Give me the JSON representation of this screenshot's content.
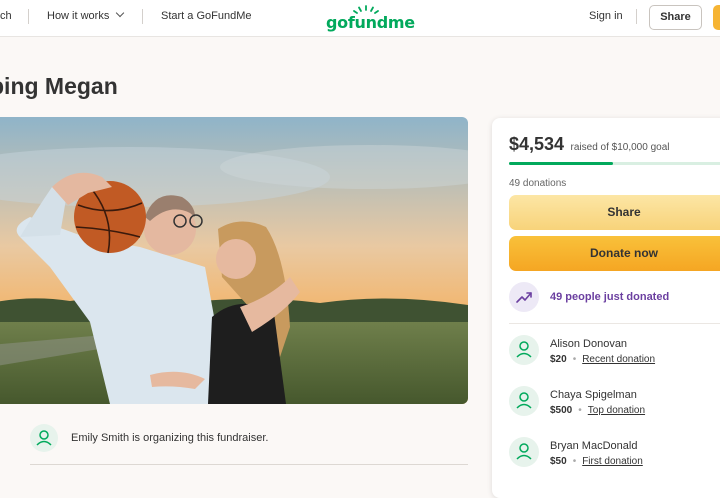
{
  "header": {
    "search_label": "ch",
    "how_it_works_label": "How it works",
    "start_label": "Start a GoFundMe",
    "logo_text": "gofundme",
    "sign_in_label": "Sign in",
    "share_label": "Share"
  },
  "page": {
    "title": "ping Megan"
  },
  "organizer": {
    "text": "Emily Smith is organizing this fundraiser."
  },
  "donate_card": {
    "raised_amount": "$4,534",
    "raised_text": "raised of $10,000 goal",
    "progress_fraction": 0.4534,
    "donation_count": "49 donations",
    "share_button": "Share",
    "donate_button": "Donate now",
    "trend_text": "49 people just donated",
    "donors": [
      {
        "name": "Alison Donovan",
        "amount": "$20",
        "tag": "Recent donation"
      },
      {
        "name": "Chaya Spigelman",
        "amount": "$500",
        "tag": "Top donation"
      },
      {
        "name": "Bryan MacDonald",
        "amount": "$50",
        "tag": "First donation"
      }
    ]
  },
  "colors": {
    "brand_green": "#02a95c",
    "donate_orange": "#f5a623",
    "trend_purple": "#6b3fa0"
  }
}
